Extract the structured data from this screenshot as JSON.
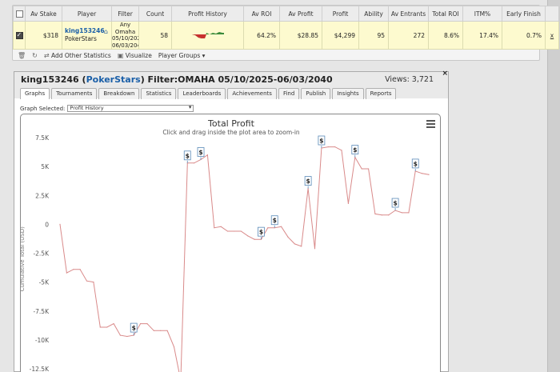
{
  "stats": {
    "headers": [
      "Av Stake",
      "Player",
      "Filter",
      "Count",
      "Profit History",
      "Av ROI",
      "Av Profit",
      "Profit",
      "Ability",
      "Av Entrants",
      "Total ROI",
      "ITM%",
      "Early Finish"
    ],
    "row": {
      "av_stake": "$318",
      "player_name": "king153246",
      "player_site": "PokerStars",
      "filter_lines": [
        "Any",
        "Omaha",
        "05/10/202",
        "06/03/204"
      ],
      "count": "58",
      "av_roi": "64.2%",
      "av_profit": "$28.85",
      "profit": "$4,299",
      "ability": "95",
      "av_entrants": "272",
      "total_roi": "8.6%",
      "itm": "17.4%",
      "early_finish": "0.7%",
      "remove": "x"
    },
    "toolbar": {
      "add_stats": "Add Other Statistics",
      "visualize": "Visualize",
      "player_groups": "Player Groups"
    }
  },
  "profile": {
    "player": "king153246",
    "site": "PokerStars",
    "filter_text": "Filter:OMAHA 05/10/2025-06/03/2040",
    "views": "Views: 3,721",
    "close": "×",
    "tabs": [
      "Graphs",
      "Tournaments",
      "Breakdown",
      "Statistics",
      "Leaderboards",
      "Achievements",
      "Find",
      "Publish",
      "Insights",
      "Reports"
    ],
    "active_tab": 0,
    "graph_selected_label": "Graph Selected:",
    "graph_selected_value": "Profit History"
  },
  "chart_data": {
    "type": "line",
    "title": "Total Profit",
    "subtitle": "Click and drag inside the plot area to zoom-in",
    "ylabel": "Cumulative Total (USD)",
    "ytick_labels": [
      "7.5K",
      "5K",
      "2.5K",
      "0",
      "-2.5K",
      "-5K",
      "-7.5K",
      "-10K",
      "-12.5K"
    ],
    "ylim": [
      -12700,
      7700
    ],
    "marker_label": "$",
    "line_color": "#d98a8a",
    "series": [
      {
        "values": [
          0,
          -4200,
          -3900,
          -3900,
          -4900,
          -5000,
          -8900,
          -8900,
          -8600,
          -9600,
          -9700,
          -9600,
          -8600,
          -8600,
          -9200,
          -9200,
          -9200,
          -10600,
          -13500,
          5300,
          5300,
          5600,
          6000,
          -300,
          -200,
          -600,
          -600,
          -600,
          -1000,
          -1300,
          -1300,
          -300,
          -300,
          -200,
          -1100,
          -1700,
          -1900,
          3100,
          -2100,
          6600,
          6700,
          6700,
          6400,
          1800,
          5800,
          4800,
          4800,
          900,
          800,
          800,
          1200,
          1000,
          1000,
          4600,
          4400,
          4300
        ]
      }
    ],
    "markers": [
      11,
      19,
      21,
      30,
      32,
      37,
      39,
      44,
      50,
      53
    ]
  }
}
